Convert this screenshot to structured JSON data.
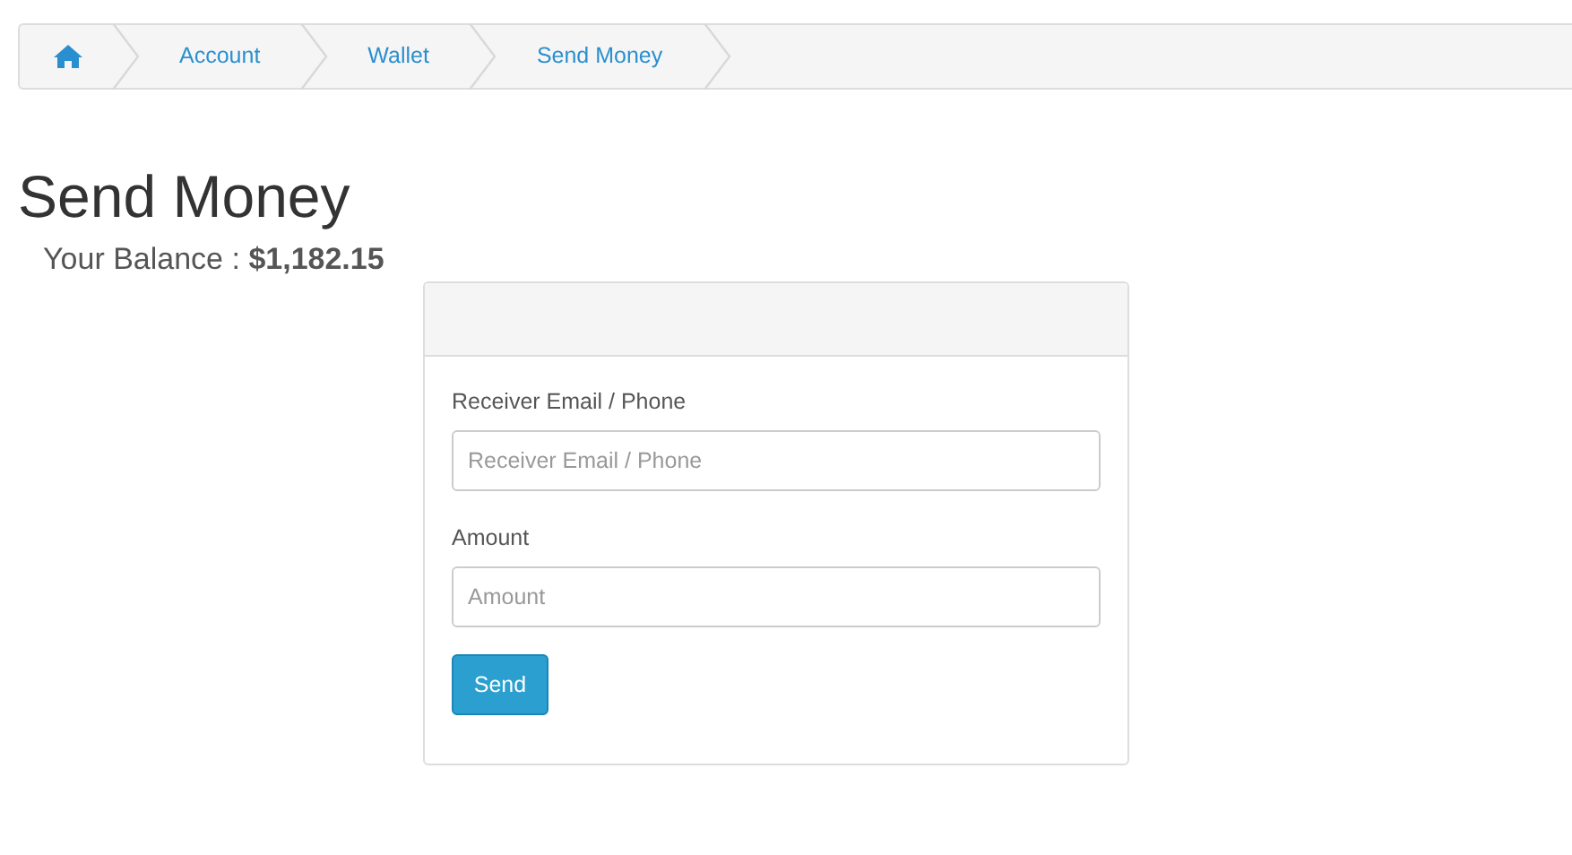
{
  "breadcrumb": [
    {
      "kind": "home"
    },
    {
      "kind": "link",
      "label": "Account"
    },
    {
      "kind": "link",
      "label": "Wallet"
    },
    {
      "kind": "link",
      "label": "Send Money"
    }
  ],
  "title": "Send Money",
  "balance": {
    "label": "Your Balance :",
    "value": "$1,182.15"
  },
  "form": {
    "fields": [
      {
        "label": "Receiver Email / Phone",
        "placeholder": "Receiver Email / Phone"
      },
      {
        "label": "Amount",
        "placeholder": "Amount"
      }
    ],
    "button": "Send"
  }
}
